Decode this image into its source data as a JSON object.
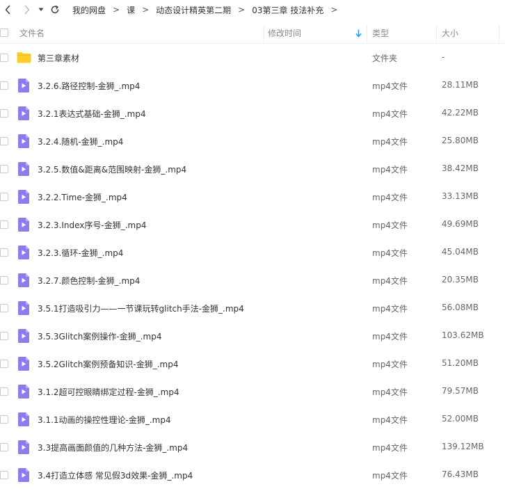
{
  "breadcrumbs": [
    "我的网盘",
    "课",
    "动态设计精英第二期",
    "03第三章 技法补充"
  ],
  "header": {
    "name": "文件名",
    "mtime": "修改时间",
    "type": "类型",
    "size": "大小"
  },
  "colors": {
    "accent": "#09aaff",
    "video_icon": "#8a7dec",
    "folder": "#ffcb2d"
  },
  "rows": [
    {
      "icon": "folder-icon",
      "name": "第三章素材",
      "type": "文件夹",
      "size": "-"
    },
    {
      "icon": "video-file-icon",
      "name": "3.2.6.路径控制-金狮_.mp4",
      "type": "mp4文件",
      "size": "28.11MB"
    },
    {
      "icon": "video-file-icon",
      "name": "3.2.1表达式基础-金狮_.mp4",
      "type": "mp4文件",
      "size": "42.22MB"
    },
    {
      "icon": "video-file-icon",
      "name": "3.2.4.随机-金狮_.mp4",
      "type": "mp4文件",
      "size": "25.80MB"
    },
    {
      "icon": "video-file-icon",
      "name": "3.2.5.数值&距离&范围映射-金狮_.mp4",
      "type": "mp4文件",
      "size": "38.42MB"
    },
    {
      "icon": "video-file-icon",
      "name": "3.2.2.Time-金狮_.mp4",
      "type": "mp4文件",
      "size": "33.13MB"
    },
    {
      "icon": "video-file-icon",
      "name": "3.2.3.Index序号-金狮_.mp4",
      "type": "mp4文件",
      "size": "49.69MB"
    },
    {
      "icon": "video-file-icon",
      "name": "3.2.3.循环-金狮_.mp4",
      "type": "mp4文件",
      "size": "45.04MB"
    },
    {
      "icon": "video-file-icon",
      "name": "3.2.7.颜色控制-金狮_.mp4",
      "type": "mp4文件",
      "size": "20.35MB"
    },
    {
      "icon": "video-file-icon",
      "name": "3.5.1打造吸引力——一节课玩转glitch手法-金狮_.mp4",
      "type": "mp4文件",
      "size": "56.08MB"
    },
    {
      "icon": "video-file-icon",
      "name": "3.5.3Glitch案例操作-金狮_.mp4",
      "type": "mp4文件",
      "size": "103.62MB"
    },
    {
      "icon": "video-file-icon",
      "name": "3.5.2Glitch案例预备知识-金狮_.mp4",
      "type": "mp4文件",
      "size": "51.20MB"
    },
    {
      "icon": "video-file-icon",
      "name": "3.1.2超可控眼睛绑定过程-金狮_.mp4",
      "type": "mp4文件",
      "size": "79.57MB"
    },
    {
      "icon": "video-file-icon",
      "name": "3.1.1动画的操控性理论-金狮_.mp4",
      "type": "mp4文件",
      "size": "52.00MB"
    },
    {
      "icon": "video-file-icon",
      "name": "3.3提高画面颜值的几种方法-金狮_.mp4",
      "type": "mp4文件",
      "size": "139.12MB"
    },
    {
      "icon": "video-file-icon",
      "name": "3.4打造立体感 常见假3d效果-金狮_.mp4",
      "type": "mp4文件",
      "size": "76.43MB"
    }
  ]
}
